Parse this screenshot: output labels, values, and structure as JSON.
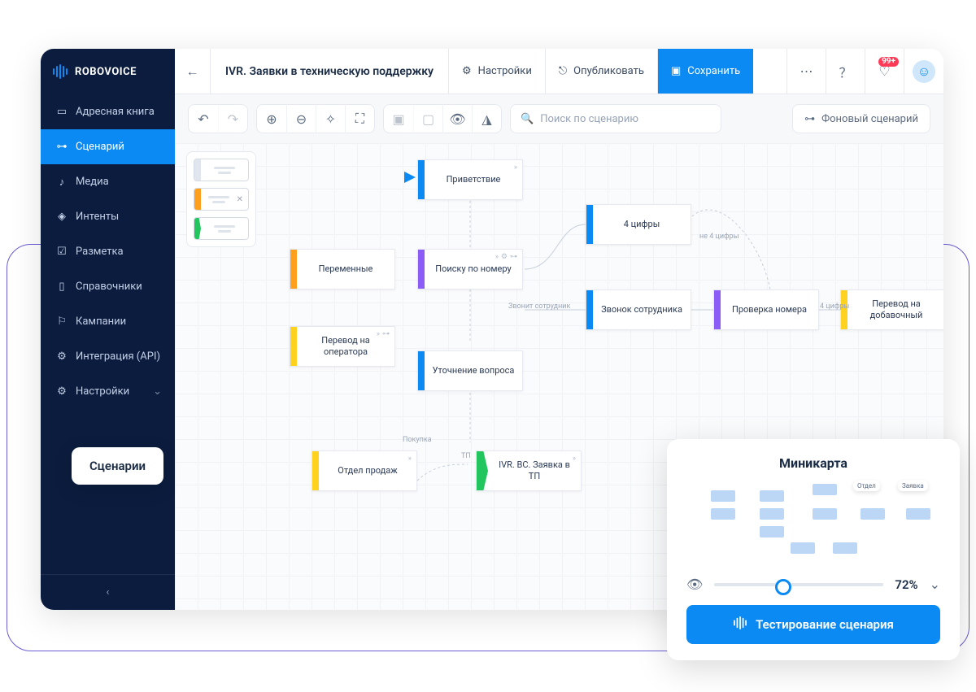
{
  "brand": {
    "name": "ROBOVOICE"
  },
  "sidebar": {
    "items": [
      {
        "label": "Адресная книга"
      },
      {
        "label": "Сценарий"
      },
      {
        "label": "Медиа"
      },
      {
        "label": "Интенты"
      },
      {
        "label": "Разметка"
      },
      {
        "label": "Справочники"
      },
      {
        "label": "Кампании"
      },
      {
        "label": "Интеграция (API)"
      },
      {
        "label": "Настройки"
      }
    ]
  },
  "header": {
    "title": "IVR. Заявки в техническую поддержку",
    "settings": "Настройки",
    "publish": "Опубликовать",
    "save": "Сохранить",
    "badge": "99+"
  },
  "toolbar": {
    "search_placeholder": "Поиск по сценарию",
    "bg_scenario": "Фоновый сценарий"
  },
  "nodes": {
    "greeting": "Приветствие",
    "variables": "Переменные",
    "search_by_number": "Поиску по номеру",
    "four_digits": "4 цифры",
    "transfer_operator": "Перевод на оператора",
    "staff_call": "Звонок сотрудника",
    "check_number": "Проверка номера",
    "transfer_ext": "Перевод на добавочный",
    "clarify": "Уточнение вопроса",
    "sales": "Отдел продаж",
    "app_tp": "IVR. ВС. Заявка в ТП"
  },
  "edges": {
    "staff_calling": "Звонит сотрудник",
    "not_four": "не 4 цифры",
    "four": "4 цифры",
    "purchase": "Покупка",
    "tp": "ТП"
  },
  "tooltip": "Сценарии",
  "minimap": {
    "title": "Миникарта",
    "percent": "72%",
    "test": "Тестирование сценария"
  },
  "colors": {
    "blue": "#0a8af2",
    "orange": "#ff9f1e",
    "green": "#22c55e",
    "purple": "#8b5cf6",
    "yellow": "#ffd21f"
  }
}
